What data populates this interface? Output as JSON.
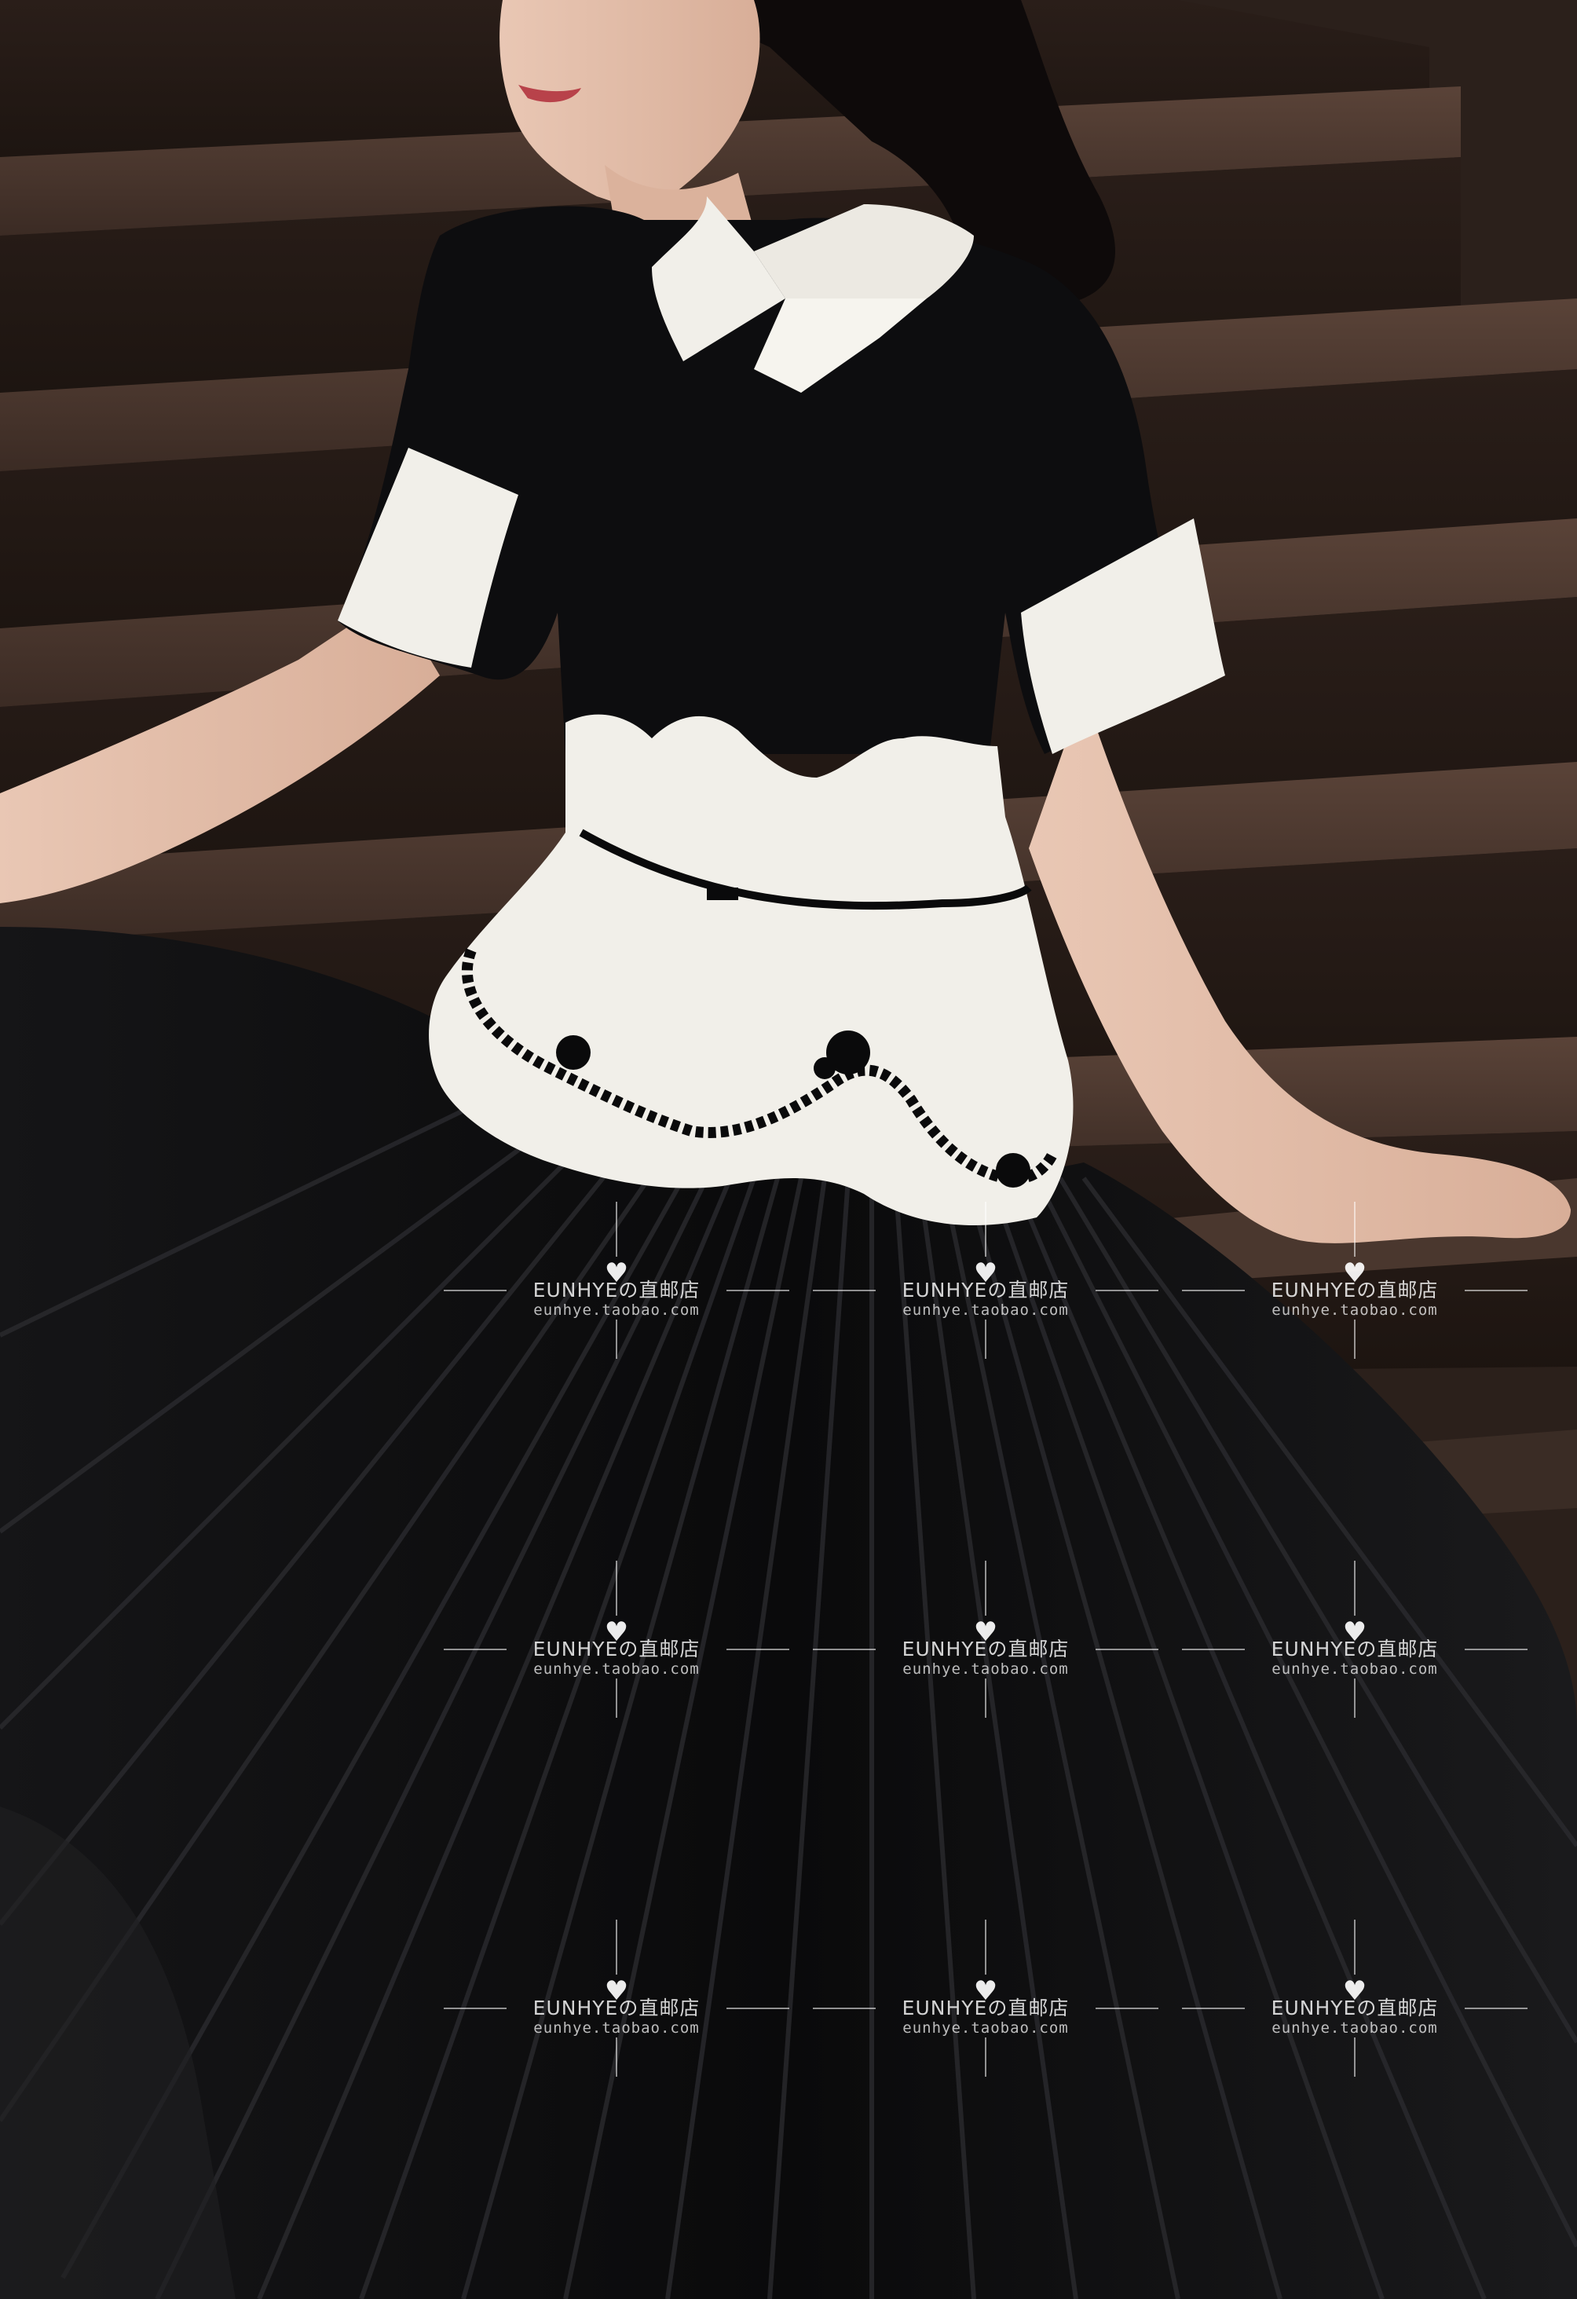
{
  "watermark": {
    "brand": "EUNHYEの直邮店",
    "url": "eunhye.taobao.com",
    "icon": "heart-icon"
  },
  "colors": {
    "stairs": "#3a2b24",
    "dress_black": "#0d0d0f",
    "dress_white": "#f1efe9",
    "skin": "#e8c6b3",
    "hair": "#0e0a0a"
  }
}
